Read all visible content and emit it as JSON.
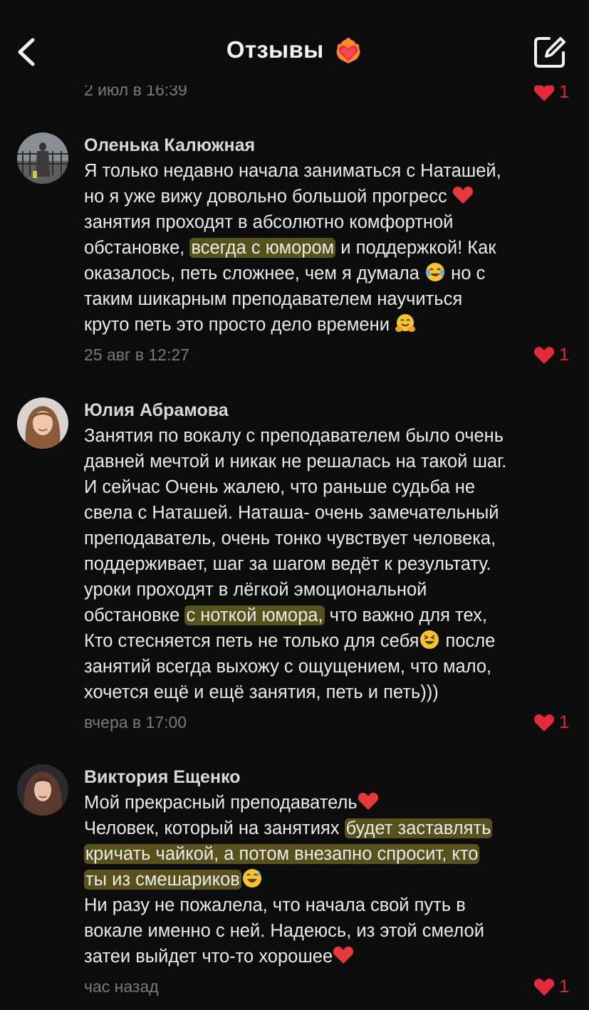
{
  "header": {
    "title": "Отзывы",
    "title_icon": "heart-on-fire-icon",
    "back_icon": "chevron-left-icon",
    "compose_icon": "compose-icon"
  },
  "previous": {
    "date": "2 июл в 16:39",
    "likes": "1"
  },
  "reviews": [
    {
      "author": "Оленька Калюжная",
      "lines": [
        [
          "Я только недавно начала заниматься с Наташей,"
        ],
        [
          "но я уже вижу довольно большой прогресс "
        ],
        [
          "занятия проходят в абсолютно комфортной"
        ],
        [
          "обстановке, ",
          "всегда с юмором",
          " и поддержкой! Как"
        ],
        [
          "оказалось, петь сложнее, чем я думала ",
          " но с"
        ],
        [
          "таким шикарным преподавателем научиться"
        ],
        [
          "круто петь это просто дело времени "
        ]
      ],
      "date": "25 авг в 12:27",
      "likes": "1"
    },
    {
      "author": "Юлия Абрамова",
      "lines": [
        [
          "Занятия по вокалу с преподавателем было очень"
        ],
        [
          "давней мечтой и никак не решалась на такой шаг."
        ],
        [
          "И сейчас Очень жалею,  что раньше судьба не"
        ],
        [
          "свела с Наташей. Наташа- очень замечательный"
        ],
        [
          "преподаватель,  очень тонко чувствует человека,"
        ],
        [
          "поддерживает, шаг за шагом ведёт к результату."
        ],
        [
          "уроки проходят в лёгкой эмоциональной"
        ],
        [
          "обстановке ",
          "с ноткой юмора,",
          "  что важно для тех,"
        ],
        [
          "Кто стесняется петь не только для себя",
          " после"
        ],
        [
          "занятий всегда выхожу  с ощущением,  что мало,"
        ],
        [
          "хочется ещё  и ещё занятия,  петь и петь)))"
        ]
      ],
      "date": "вчера в 17:00",
      "likes": "1"
    },
    {
      "author": "Виктория Ещенко",
      "lines": [
        [
          "Мой прекрасный преподаватель"
        ],
        [
          "Человек, который на занятиях ",
          "будет заставлять"
        ],
        [
          "кричать чайкой, а потом внезапно спросит, кто"
        ],
        [
          "ты из смешариков"
        ],
        [
          "Ни разу не пожалела, что начала свой путь в"
        ],
        [
          "вокале именно с ней. Надеюсь, из этой смелой"
        ],
        [
          "затеи выйдет что-то хорошее"
        ]
      ],
      "date": "час назад",
      "likes": "1"
    }
  ],
  "colors": {
    "background": "#0c0c0c",
    "like": "#e22a3a",
    "highlight": "#8c8428",
    "meta": "#7b7b7b"
  }
}
